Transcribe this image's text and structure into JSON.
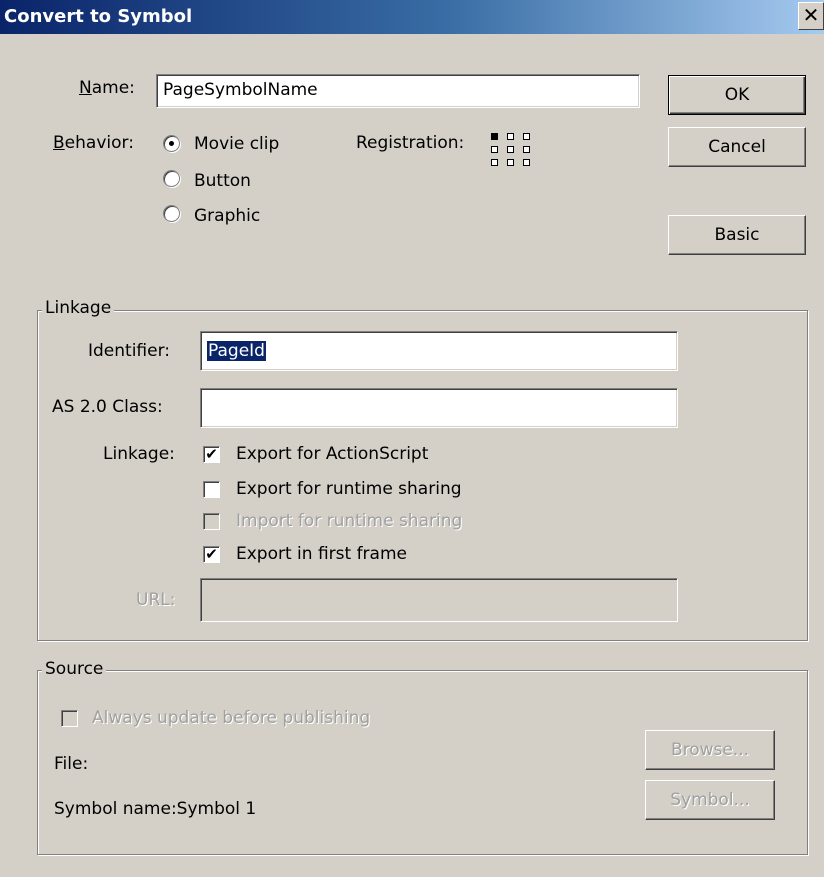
{
  "window": {
    "title": "Convert to Symbol",
    "close_glyph": "✕"
  },
  "name": {
    "label_ul": "N",
    "label_rest": "ame:",
    "value": "PageSymbolName"
  },
  "behavior": {
    "label_ul": "B",
    "label_rest": "ehavior:",
    "options": [
      {
        "label": "Movie clip",
        "selected": true
      },
      {
        "label": "Button",
        "selected": false
      },
      {
        "label": "Graphic",
        "selected": false
      }
    ]
  },
  "registration": {
    "label": "Registration:",
    "selected_cell": "top-left"
  },
  "buttons": {
    "ok": "OK",
    "cancel": "Cancel",
    "basic": "Basic"
  },
  "linkage": {
    "group_label": "Linkage",
    "identifier_label": "Identifier:",
    "identifier_value": "PageId",
    "class_label": "AS 2.0 Class:",
    "class_value": "",
    "linkage_label": "Linkage:",
    "checks": [
      {
        "label": "Export for ActionScript",
        "checked": true,
        "enabled": true
      },
      {
        "label": "Export for runtime sharing",
        "checked": false,
        "enabled": true
      },
      {
        "label": "Import for runtime sharing",
        "checked": false,
        "enabled": false
      },
      {
        "label": "Export in first frame",
        "checked": true,
        "enabled": true
      }
    ],
    "url_label": "URL:",
    "url_value": ""
  },
  "source": {
    "group_label": "Source",
    "always_update_label": "Always update before publishing",
    "file_label": "File:",
    "symbol_name_text": "Symbol name:Symbol 1",
    "browse_button": "Browse...",
    "symbol_button": "Symbol..."
  },
  "check_glyph": "✔"
}
